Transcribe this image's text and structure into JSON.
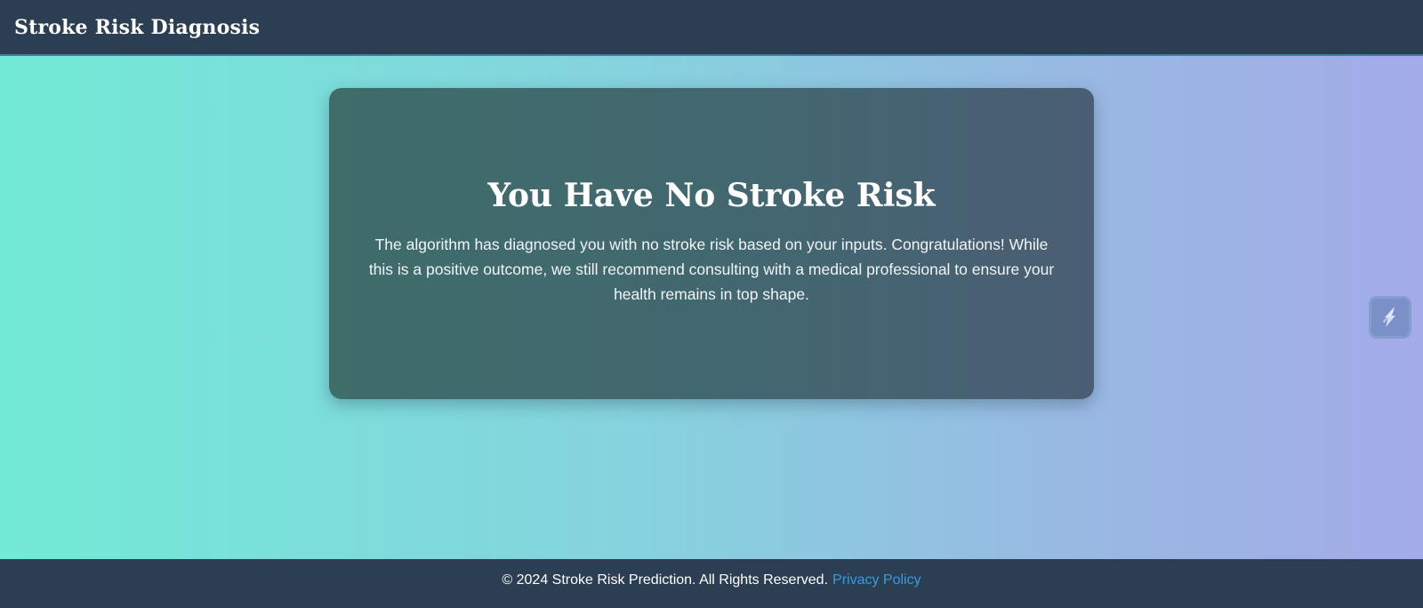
{
  "header": {
    "title": "Stroke Risk Diagnosis"
  },
  "result": {
    "title": "You Have No Stroke Risk",
    "message": "The algorithm has diagnosed you with no stroke risk based on your inputs. Congratulations! While this is a positive outcome, we still recommend consulting with a medical professional to ensure your health remains in top shape."
  },
  "side_widget": {
    "icon": "lightning-bolt-icon"
  },
  "footer": {
    "copyright": "© 2024 Stroke Risk Prediction. All Rights Reserved.",
    "privacy_link": "Privacy Policy"
  },
  "colors": {
    "header_bg": "#2c3e52",
    "card_bg_start": "#3e6d6a",
    "card_bg_end": "#4a5e73",
    "gradient_start": "#72ead6",
    "gradient_end": "#a3abe8",
    "link": "#3b9be0"
  }
}
